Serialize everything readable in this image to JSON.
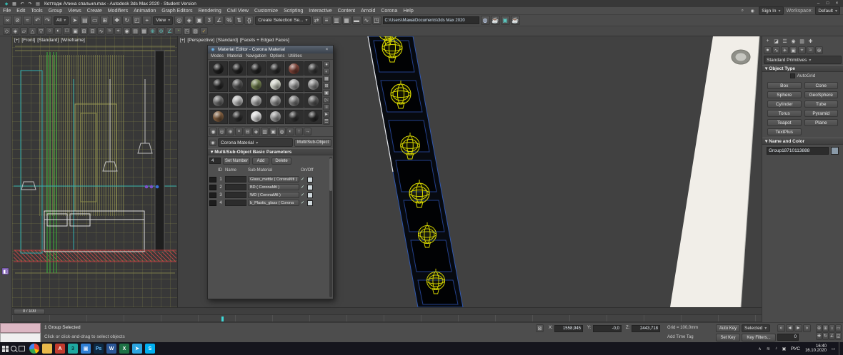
{
  "glyphs": {
    "rollout_arrow": "▾",
    "lock": "⊠",
    "close": "×",
    "min": "–",
    "max": "□",
    "person": "◉",
    "search": "⌕",
    "tray_chevron": "∧",
    "notif": "▭"
  },
  "titlebar": {
    "title": "Коттедж Алина спальня.max - Autodesk 3ds Max 2020 - Student Version",
    "quick_icons": [
      {
        "name": "3dsmax-logo-icon",
        "glyph": "◆",
        "color": "#35b5ad"
      },
      {
        "name": "save-icon",
        "glyph": "▦"
      },
      {
        "name": "undo-icon",
        "glyph": "↶"
      },
      {
        "name": "redo-icon",
        "glyph": "↷"
      },
      {
        "name": "project-folder-icon",
        "glyph": "▤"
      }
    ]
  },
  "menu": {
    "items": [
      "File",
      "Edit",
      "Tools",
      "Group",
      "Views",
      "Create",
      "Modifiers",
      "Animation",
      "Graph Editors",
      "Rendering",
      "Civil View",
      "Customize",
      "Scripting",
      "Interactive",
      "Content",
      "Arnold",
      "Corona",
      "Help"
    ]
  },
  "account": {
    "sign_in": "Sign In",
    "workspace_label": "Workspace:",
    "workspace_value": "Default"
  },
  "toolbar": {
    "icons_link": [
      {
        "name": "select-and-link-icon",
        "glyph": "∞"
      },
      {
        "name": "unlink-selection-icon",
        "glyph": "⊘"
      },
      {
        "name": "bind-to-space-warp-icon",
        "glyph": "≈"
      },
      {
        "name": "undo-icon",
        "glyph": "↶"
      },
      {
        "name": "redo-icon",
        "glyph": "↷"
      }
    ],
    "filter_dd": "All",
    "icons_select": [
      {
        "name": "select-object-icon",
        "glyph": "➤"
      },
      {
        "name": "select-by-name-icon",
        "glyph": "▤"
      },
      {
        "name": "rectangular-selection-icon",
        "glyph": "▭"
      },
      {
        "name": "window-crossing-icon",
        "glyph": "⊞"
      }
    ],
    "icons_transform": [
      {
        "name": "select-and-move-icon",
        "glyph": "✚"
      },
      {
        "name": "select-and-rotate-icon",
        "glyph": "↻"
      },
      {
        "name": "select-and-scale-icon",
        "glyph": "◰"
      },
      {
        "name": "select-and-place-icon",
        "glyph": "⌖"
      }
    ],
    "coord_dd": "View",
    "icons_pivot": [
      {
        "name": "use-pivot-center-icon",
        "glyph": "◎"
      },
      {
        "name": "select-and-manipulate-icon",
        "glyph": "◈"
      },
      {
        "name": "keyboard-override-icon",
        "glyph": "▣"
      },
      {
        "name": "snaps-toggle-icon",
        "glyph": "3"
      },
      {
        "name": "angle-snap-icon",
        "glyph": "∠"
      },
      {
        "name": "percent-snap-icon",
        "glyph": "%"
      },
      {
        "name": "spinner-snap-icon",
        "glyph": "⇅"
      },
      {
        "name": "named-selection-sets-icon",
        "glyph": "{}"
      }
    ],
    "sets_dd": "Create Selection Se...",
    "icons_tools": [
      {
        "name": "mirror-icon",
        "glyph": "⇄"
      },
      {
        "name": "align-icon",
        "glyph": "≡"
      },
      {
        "name": "scene-explorer-icon",
        "glyph": "▥"
      },
      {
        "name": "layer-explorer-icon",
        "glyph": "▦"
      },
      {
        "name": "ribbon-toggle-icon",
        "glyph": "▬"
      },
      {
        "name": "curve-editor-icon",
        "glyph": "∿"
      },
      {
        "name": "schematic-view-icon",
        "glyph": "◳"
      }
    ],
    "project_path": "C:\\Users\\Мама\\Documents\\3ds Max 2020",
    "icons_render": [
      {
        "name": "material-editor-icon",
        "glyph": "◍",
        "color": "#cfe0ff"
      },
      {
        "name": "render-setup-icon",
        "glyph": "☕",
        "color": "#5bc8c0"
      },
      {
        "name": "rendered-frame-icon",
        "glyph": "▣",
        "color": "#5bc8c0"
      },
      {
        "name": "render-production-icon",
        "glyph": "☕",
        "color": "#5bc8c0"
      }
    ],
    "ribbon_icons": [
      {
        "name": "toolbar2-icon",
        "glyph": "◇"
      },
      {
        "name": "toolbar2-icon",
        "glyph": "◈"
      },
      {
        "name": "toolbar2-icon",
        "glyph": "▱"
      },
      {
        "name": "toolbar2-icon",
        "glyph": "△"
      },
      {
        "name": "toolbar2-icon",
        "glyph": "▽"
      },
      {
        "name": "toolbar2-icon",
        "glyph": "○"
      },
      {
        "name": "toolbar2-icon",
        "glyph": "◐"
      },
      {
        "name": "toolbar2-icon",
        "glyph": "□"
      },
      {
        "name": "toolbar2-icon",
        "glyph": "▣"
      },
      {
        "name": "toolbar2-icon",
        "glyph": "⊞"
      },
      {
        "name": "toolbar2-icon",
        "glyph": "⊟"
      },
      {
        "name": "toolbar2-icon",
        "glyph": "∿"
      },
      {
        "name": "toolbar2-icon",
        "glyph": "≈"
      },
      {
        "name": "toolbar2-icon",
        "glyph": "⌖"
      },
      {
        "name": "toolbar2-icon",
        "glyph": "◉"
      },
      {
        "name": "toolbar2-icon",
        "glyph": "▤"
      },
      {
        "name": "toolbar2-icon",
        "glyph": "▦"
      },
      {
        "name": "toolbar2-icon",
        "glyph": "⊕",
        "color": "#5bc8c0"
      },
      {
        "name": "toolbar2-icon",
        "glyph": "⊖",
        "color": "#5bc8c0"
      },
      {
        "name": "toolbar2-icon",
        "glyph": "∠",
        "color": "#5bc8c0"
      },
      {
        "name": "toolbar2-icon",
        "glyph": "◔",
        "color": "#8fba5a"
      },
      {
        "name": "toolbar2-icon",
        "glyph": "◳"
      },
      {
        "name": "toolbar2-icon",
        "glyph": "▧"
      },
      {
        "name": "toolbar2-icon",
        "glyph": "✓",
        "color": "#c9a54a"
      }
    ]
  },
  "viewports": {
    "left": {
      "plus": "[+]",
      "view": "[Front]",
      "renderer": "[Standard]",
      "shading": "[Wireframe]"
    },
    "main": {
      "plus": "[+]",
      "view": "[Perspective]",
      "renderer": "[Standard]",
      "shading": "[Facets + Edged Faces]"
    }
  },
  "material_editor": {
    "title": "Material Editor - Corona Material",
    "menus": [
      "Modes",
      "Material",
      "Navigation",
      "Options",
      "Utilities"
    ],
    "slots": [
      "#1f1f1f",
      "#242424",
      "#262626",
      "#2e2e2e",
      "#7a4136",
      "#3c3c3c",
      "#2a2a2a",
      "#555555",
      "#6f7d4e",
      "#cfd2c6",
      "#9d9d9d",
      "#8a8a8a",
      "#6e6e6e",
      "#b9b9b9",
      "#a8a8a8",
      "#8f8f8f",
      "#7c7c7c",
      "#5c5c5c",
      "#7b5a3c",
      "#303030",
      "#d8d8d8",
      "#9a9a9a",
      "#343434",
      "#2b2b2b"
    ],
    "side_icons": [
      {
        "name": "sample-type-icon",
        "glyph": "●"
      },
      {
        "name": "backlight-icon",
        "glyph": "◐"
      },
      {
        "name": "background-icon",
        "glyph": "▦"
      },
      {
        "name": "sample-uv-tiling-icon",
        "glyph": "⊞"
      },
      {
        "name": "video-color-check-icon",
        "glyph": "▣"
      },
      {
        "name": "make-preview-icon",
        "glyph": "▷"
      },
      {
        "name": "options-icon",
        "glyph": "≡"
      },
      {
        "name": "select-by-material-icon",
        "glyph": "►"
      },
      {
        "name": "material-map-navigator-icon",
        "glyph": "☰"
      }
    ],
    "toolbar_icons": [
      {
        "name": "get-material-icon",
        "glyph": "◉"
      },
      {
        "name": "put-material-icon",
        "glyph": "◎"
      },
      {
        "name": "assign-material-icon",
        "glyph": "⊕"
      },
      {
        "name": "reset-map-icon",
        "glyph": "×"
      },
      {
        "name": "make-copy-icon",
        "glyph": "⊟"
      },
      {
        "name": "make-unique-icon",
        "glyph": "◈"
      },
      {
        "name": "put-to-library-icon",
        "glyph": "▥"
      },
      {
        "name": "material-id-icon",
        "glyph": "▣"
      },
      {
        "name": "show-map-icon",
        "glyph": "◍"
      },
      {
        "name": "show-end-result-icon",
        "glyph": "◐"
      },
      {
        "name": "go-to-parent-icon",
        "glyph": "↑"
      },
      {
        "name": "go-forward-icon",
        "glyph": "→"
      }
    ],
    "name_dd": "Corona Material",
    "type_button": "Multi/Sub-Object",
    "rollout_title": "Multi/Sub-Object Basic Parameters",
    "count_field": "4",
    "set_number": "Set Number",
    "add_btn": "Add",
    "delete_btn": "Delete",
    "col_id": "ID",
    "col_name": "Name",
    "col_sub": "Sub-Material",
    "col_onoff": "On/Off",
    "rows": [
      {
        "id": "1",
        "sub": "Glass_mettle ( CoronaMtl )",
        "on": "✓"
      },
      {
        "id": "2",
        "sub": "BD ( CoronaMtl )",
        "on": "✓"
      },
      {
        "id": "3",
        "sub": "WD ( CoronaMtl )",
        "on": "✓"
      },
      {
        "id": "4",
        "sub": "b_Plastic_glass ( Corona",
        "on": "✓"
      }
    ]
  },
  "command_panel": {
    "tabs": [
      {
        "name": "create-tab-icon",
        "glyph": "+"
      },
      {
        "name": "modify-tab-icon",
        "glyph": "◪"
      },
      {
        "name": "hierarchy-tab-icon",
        "glyph": "☰"
      },
      {
        "name": "motion-tab-icon",
        "glyph": "◉"
      },
      {
        "name": "display-tab-icon",
        "glyph": "▥"
      },
      {
        "name": "utilities-tab-icon",
        "glyph": "✚"
      }
    ],
    "categories": [
      {
        "name": "geometry-category-icon",
        "glyph": "●"
      },
      {
        "name": "shapes-category-icon",
        "glyph": "∿"
      },
      {
        "name": "lights-category-icon",
        "glyph": "☀"
      },
      {
        "name": "cameras-category-icon",
        "glyph": "▣"
      },
      {
        "name": "helpers-category-icon",
        "glyph": "⌖"
      },
      {
        "name": "space-warps-category-icon",
        "glyph": "≈"
      },
      {
        "name": "systems-category-icon",
        "glyph": "⊛"
      }
    ],
    "subcategory_dd": "Standard Primitives",
    "object_type_title": "Object Type",
    "autogrid_label": "AutoGrid",
    "object_buttons": [
      "Box",
      "Cone",
      "Sphere",
      "GeoSphere",
      "Cylinder",
      "Tube",
      "Torus",
      "Pyramid",
      "Teapot",
      "Plane",
      "TextPlus"
    ],
    "name_color_title": "Name and Color",
    "object_name": "Group18710113888"
  },
  "timeline": {
    "slider_label": "0 / 100"
  },
  "statusbar": {
    "selection_text": "1 Group Selected",
    "hint_text": "Click or click-and-drag to select objects",
    "x_label": "X:",
    "y_label": "Y:",
    "z_label": "Z:",
    "x_value": "1558,945",
    "y_value": "-0,0",
    "z_value": "2443,718",
    "grid_text": "Grid = 100,0mm",
    "time_tag": "Add Time Tag",
    "auto_key": "Auto Key",
    "set_key": "Set Key",
    "selected_dd": "Selected",
    "key_filters": "Key Filters...",
    "frame_value": "0",
    "playback": [
      {
        "name": "go-to-start-button",
        "glyph": "«"
      },
      {
        "name": "previous-frame-button",
        "glyph": "◄"
      },
      {
        "name": "play-button",
        "glyph": "►"
      },
      {
        "name": "go-to-end-button",
        "glyph": "»"
      }
    ],
    "nav_icons": [
      {
        "name": "zoom-icon",
        "glyph": "⊕"
      },
      {
        "name": "zoom-all-icon",
        "glyph": "⊞"
      },
      {
        "name": "zoom-extents-icon",
        "glyph": "⌂"
      },
      {
        "name": "zoom-region-icon",
        "glyph": "▭"
      },
      {
        "name": "pan-icon",
        "glyph": "✚"
      },
      {
        "name": "orbit-icon",
        "glyph": "↻"
      },
      {
        "name": "field-of-view-icon",
        "glyph": "∠"
      },
      {
        "name": "maximize-viewport-icon",
        "glyph": "◱"
      }
    ]
  },
  "taskbar": {
    "language": "РУС",
    "time": "16:40",
    "date": "16.10.2020",
    "apps": [
      {
        "name": "taskbar-chrome-icon",
        "label": "",
        "bg": "conic-gradient(#ea4335 0 30%,#fbbc05 30% 45%,#34a853 45% 72%,#4285f4 72% 100%)",
        "radius": "50%"
      },
      {
        "name": "taskbar-explorer-icon",
        "label": "",
        "bg": "#e8b84a"
      },
      {
        "name": "taskbar-autodesk-icon",
        "label": "A",
        "bg": "#c23b2e",
        "fg": "#ffffff"
      },
      {
        "name": "taskbar-3dsmax-icon",
        "label": "3",
        "bg": "#1fa8a0",
        "fg": "#04343a"
      },
      {
        "name": "taskbar-photos-icon",
        "label": "▣",
        "bg": "#2f7fd4",
        "fg": "#d8e8ff"
      },
      {
        "name": "taskbar-photoshop-icon",
        "label": "Ps",
        "bg": "#0d2a44",
        "fg": "#6cc1ff"
      },
      {
        "name": "taskbar-word-icon",
        "label": "W",
        "bg": "#2b5797",
        "fg": "#ffffff"
      },
      {
        "name": "taskbar-excel-icon",
        "label": "X",
        "bg": "#1e7145",
        "fg": "#ffffff"
      },
      {
        "name": "taskbar-telegram-icon",
        "label": "➤",
        "bg": "#2ca5e0",
        "fg": "#ffffff"
      },
      {
        "name": "taskbar-skype-icon",
        "label": "S",
        "bg": "#00aff0",
        "fg": "#ffffff"
      }
    ],
    "tray_icons": [
      {
        "name": "tray-network-icon",
        "glyph": "≋"
      },
      {
        "name": "tray-volume-icon",
        "glyph": "♪"
      },
      {
        "name": "tray-shield-icon",
        "glyph": "▣"
      }
    ]
  }
}
